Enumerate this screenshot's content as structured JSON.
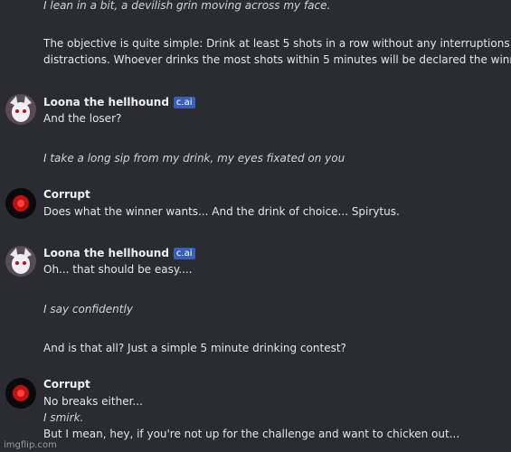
{
  "messages": [
    {
      "type": "text",
      "italic": true,
      "text": "I lean in a bit, a devilish grin moving across my face."
    },
    {
      "type": "text",
      "italic": false,
      "text": "The objective is quite simple: Drink at least 5 shots in a row without any interruptions or"
    },
    {
      "type": "text",
      "italic": false,
      "text": "distractions. Whoever drinks the most shots within 5 minutes will be declared the winner."
    },
    {
      "author": "Loona the hellhound",
      "badge": "c.ai",
      "avatar": "loona-avatar"
    },
    {
      "type": "text",
      "italic": false,
      "text": "And the loser?"
    },
    {
      "type": "text",
      "italic": true,
      "text": "I take a long sip from my drink, my eyes fixated on you"
    },
    {
      "author": "Corrupt",
      "avatar": "corrupt-avatar"
    },
    {
      "type": "text",
      "italic": false,
      "text": "Does what the winner wants... And the drink of choice... Spirytus."
    },
    {
      "author": "Loona the hellhound",
      "badge": "c.ai",
      "avatar": "loona-avatar"
    },
    {
      "type": "text",
      "italic": false,
      "text": "Oh... that should be easy...."
    },
    {
      "type": "text",
      "italic": true,
      "text": "I say confidently"
    },
    {
      "type": "text",
      "italic": false,
      "text": "And is that all? Just a simple 5 minute drinking contest?"
    },
    {
      "author": "Corrupt",
      "avatar": "corrupt-avatar"
    },
    {
      "type": "text",
      "italic": false,
      "text": "No breaks either..."
    },
    {
      "type": "text",
      "italic": true,
      "text": "I smirk."
    },
    {
      "type": "text",
      "italic": false,
      "text": "But I mean, hey, if you're not up for the challenge and want to chicken out..."
    }
  ],
  "watermark": "imgflip.com",
  "colors": {
    "background": "#2a2c31",
    "badge": "#3a5fb8"
  }
}
